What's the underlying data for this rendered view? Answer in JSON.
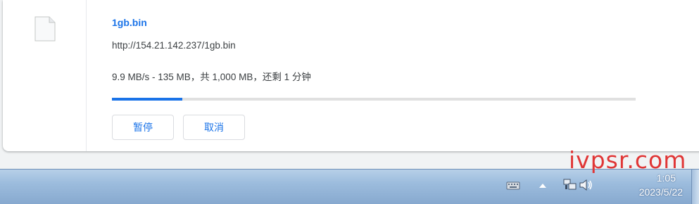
{
  "download": {
    "filename": "1gb.bin",
    "url": "http://154.21.142.237/1gb.bin",
    "status": "9.9 MB/s - 135 MB，共 1,000 MB，还剩 1 分钟",
    "progress_fraction": 0.135,
    "pause_label": "暂停",
    "cancel_label": "取消"
  },
  "taskbar": {
    "time": "1:05",
    "date": "2023/5/22"
  },
  "watermark": "ivpsr.com",
  "colors": {
    "accent": "#1a73e8",
    "watermark": "#e03636"
  }
}
